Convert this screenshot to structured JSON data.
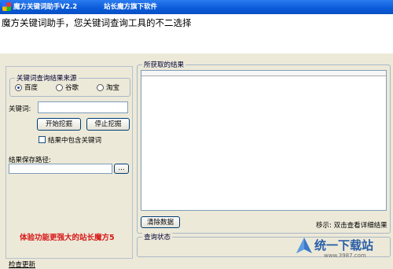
{
  "window": {
    "title": "魔方关键词助手V2.2",
    "subtitle": "站长魔方旗下软件"
  },
  "banner": {
    "text": "魔方关键词助手，您关键词查询工具的不二选择"
  },
  "source_group": {
    "legend": "关键词查询结果来源",
    "options": [
      {
        "label": "百度",
        "selected": true
      },
      {
        "label": "谷歌",
        "selected": false
      },
      {
        "label": "淘宝",
        "selected": false
      }
    ]
  },
  "keyword": {
    "label": "关键词:",
    "value": "",
    "start_button": "开始挖掘",
    "stop_button": "停止挖掘",
    "include_label": "结果中包含关键词",
    "include_checked": false
  },
  "save": {
    "label": "结果保存路径:",
    "value": "",
    "browse_button": "..."
  },
  "promo": "体验功能更强大的站长魔方5",
  "update_link": "检查更新",
  "results": {
    "legend": "所获取的结果",
    "clear_button": "清除数据",
    "hint": "移示: 双击查看详细结果"
  },
  "status": {
    "legend": "查询状态"
  },
  "watermark": {
    "text": "统一下载站",
    "url": "www.3987.com"
  },
  "colors": {
    "titlebar": "#0a5ad8",
    "promo": "#d71919",
    "watermark": "#2a5fa8"
  }
}
